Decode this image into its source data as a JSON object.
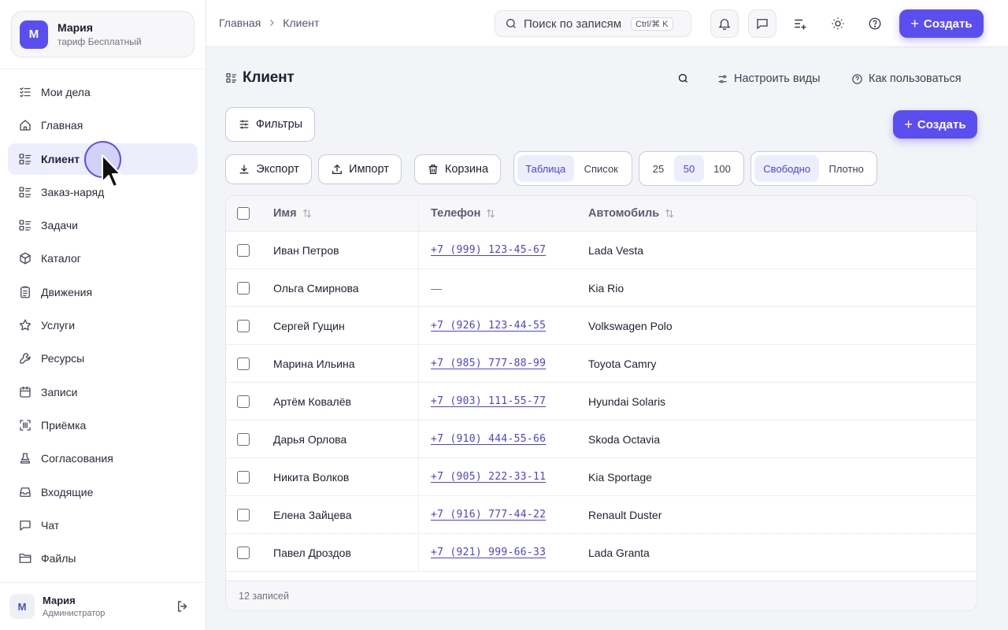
{
  "org": {
    "avatar": "M",
    "name": "Мария",
    "plan": "тариф Бесплатный"
  },
  "sidebar": {
    "items": [
      {
        "label": "Мои дела",
        "icon": "checklist-icon"
      },
      {
        "label": "Главная",
        "icon": "home-icon"
      },
      {
        "label": "Клиент",
        "icon": "list-icon",
        "active": true
      },
      {
        "label": "Заказ-наряд",
        "icon": "list-icon"
      },
      {
        "label": "Задачи",
        "icon": "list-icon"
      },
      {
        "label": "Каталог",
        "icon": "box-icon"
      },
      {
        "label": "Движения",
        "icon": "clipboard-icon"
      },
      {
        "label": "Услуги",
        "icon": "star-icon"
      },
      {
        "label": "Ресурсы",
        "icon": "wrench-icon"
      },
      {
        "label": "Записи",
        "icon": "calendar-icon"
      },
      {
        "label": "Приёмка",
        "icon": "scan-icon"
      },
      {
        "label": "Согласования",
        "icon": "stamp-icon"
      },
      {
        "label": "Входящие",
        "icon": "inbox-icon"
      },
      {
        "label": "Чат",
        "icon": "chat-icon"
      },
      {
        "label": "Файлы",
        "icon": "folder-icon"
      }
    ]
  },
  "user": {
    "avatar": "M",
    "name": "Мария",
    "role": "Администратор"
  },
  "header": {
    "breadcrumbs": [
      "Главная",
      "Клиент"
    ],
    "search_placeholder": "Поиск по записям",
    "search_shortcut": "Ctrl/⌘ K",
    "create_label": "Создать"
  },
  "main": {
    "title": "Клиент",
    "configure_views": "Настроить виды",
    "how_to_use": "Как пользоваться",
    "filters": "Фильтры",
    "create_label": "Создать",
    "export": "Экспорт",
    "import": "Импорт",
    "trash": "Корзина",
    "view_modes": [
      "Таблица",
      "Список"
    ],
    "view_mode_selected": "Таблица",
    "page_sizes": [
      "25",
      "50",
      "100"
    ],
    "page_size_selected": "50",
    "density": [
      "Свободно",
      "Плотно"
    ],
    "density_selected": "Свободно"
  },
  "table": {
    "columns": [
      "Имя",
      "Телефон",
      "Автомобиль"
    ],
    "rows": [
      {
        "name": "Иван Петров",
        "phone": "+7 (999) 123-45-67",
        "car": "Lada Vesta"
      },
      {
        "name": "Ольга Смирнова",
        "phone": "—",
        "car": "Kia Rio"
      },
      {
        "name": "Сергей Гущин",
        "phone": "+7 (926) 123-44-55",
        "car": "Volkswagen Polo"
      },
      {
        "name": "Марина Ильина",
        "phone": "+7 (985) 777-88-99",
        "car": "Toyota Camry"
      },
      {
        "name": "Артём Ковалёв",
        "phone": "+7 (903) 111-55-77",
        "car": "Hyundai Solaris"
      },
      {
        "name": "Дарья Орлова",
        "phone": "+7 (910) 444-55-66",
        "car": "Skoda Octavia"
      },
      {
        "name": "Никита Волков",
        "phone": "+7 (905) 222-33-11",
        "car": "Kia Sportage"
      },
      {
        "name": "Елена Зайцева",
        "phone": "+7 (916) 777-44-22",
        "car": "Renault Duster"
      },
      {
        "name": "Павел Дроздов",
        "phone": "+7 (921) 999-66-33",
        "car": "Lada Granta"
      }
    ],
    "footer": "12 записей"
  },
  "colors": {
    "accent": "#5b4ef0",
    "active_bg": "#eceefc",
    "link": "#4b44d8"
  }
}
